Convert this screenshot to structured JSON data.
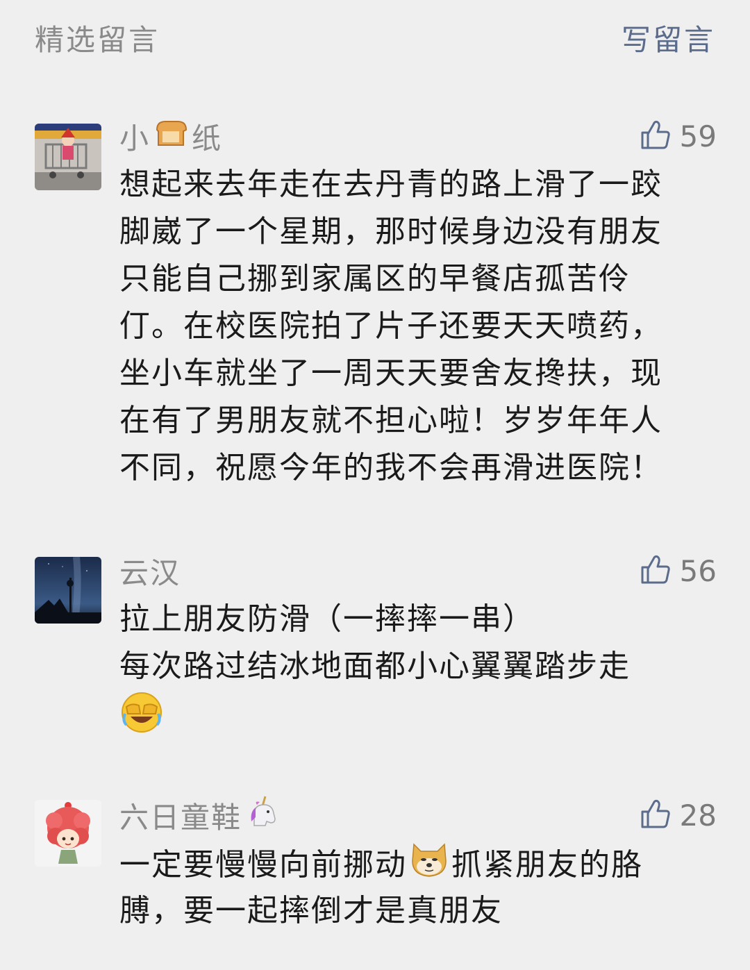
{
  "header": {
    "title": "精选留言",
    "write_label": "写留言"
  },
  "comments": [
    {
      "nickname_before": "小",
      "nickname_emoji": "bread-emoji",
      "nickname_after": "纸",
      "likes": "59",
      "lines": [
        "想起来去年走在去丹青的路上滑了一跤",
        "脚崴了一个星期，那时候身边没有朋友",
        "只能自己挪到家属区的早餐店孤苦伶",
        "仃。在校医院拍了片子还要天天喷药，",
        "坐小车就坐了一周天天要舍友搀扶，现",
        "在有了男朋友就不担心啦！岁岁年年人",
        "不同，祝愿今年的我不会再滑进医院！"
      ]
    },
    {
      "nickname": "云汉",
      "likes": "56",
      "lines": [
        "拉上朋友防滑（一摔摔一串）",
        "每次路过结冰地面都小心翼翼踏步走"
      ],
      "trailing_emoji": "facepalm-laugh-emoji"
    },
    {
      "nickname": "六日童鞋",
      "nickname_emoji": "unicorn-emoji",
      "likes": "28",
      "line1_before": "一定要慢慢向前挪动",
      "line1_emoji": "doge-emoji",
      "line1_after": "抓紧朋友的胳",
      "line2": "膊，要一起摔倒才是真朋友"
    }
  ],
  "icons": {
    "like": "thumbs-up-outline-icon"
  },
  "colors": {
    "background": "#efefef",
    "meta_gray": "#8a8a8a",
    "link_blue": "#5a6b8c",
    "text": "#1a1a1a"
  }
}
